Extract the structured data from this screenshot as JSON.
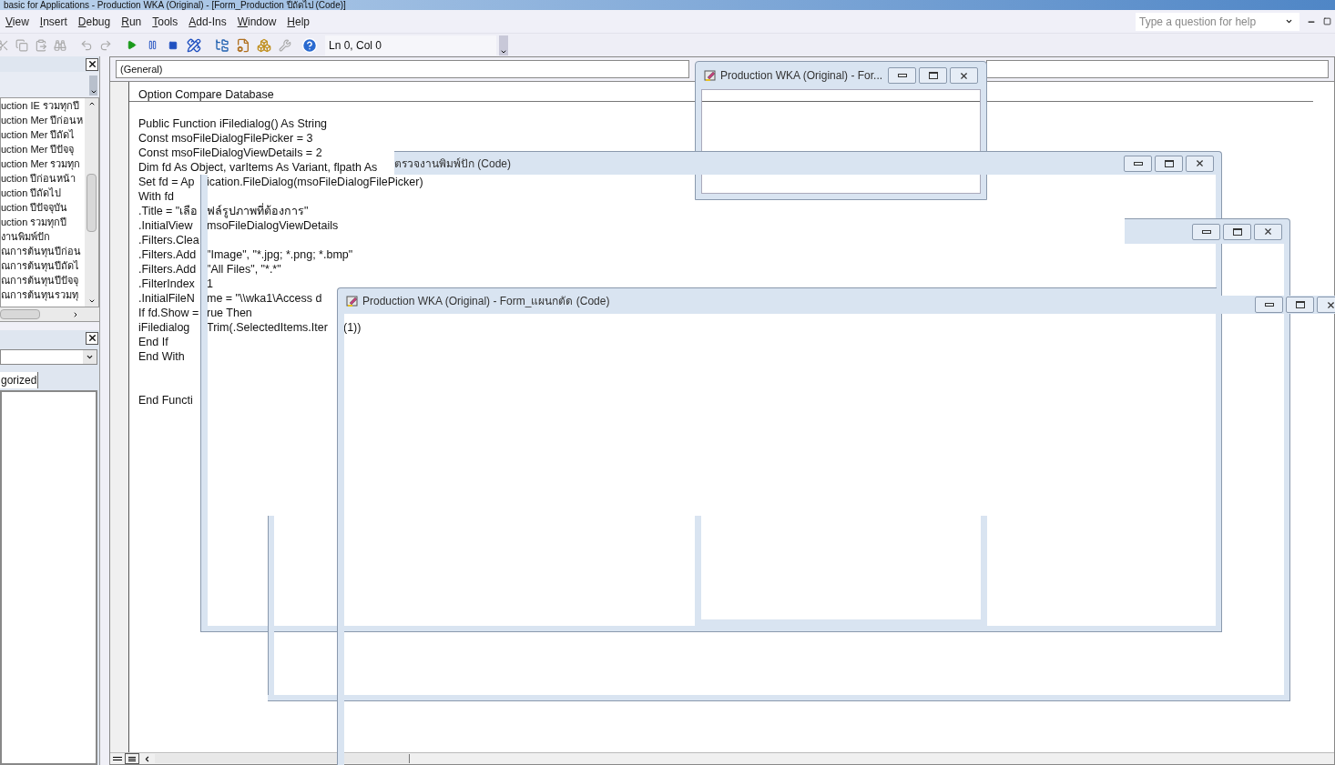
{
  "title_bar": {
    "title": "basic for Applications - Production WKA (Original) - [Form_Production ปีถัดไป (Code)]"
  },
  "menu": [
    "View",
    "Insert",
    "Debug",
    "Run",
    "Tools",
    "Add-Ins",
    "Window",
    "Help"
  ],
  "help_search": {
    "placeholder": "Type a question for help"
  },
  "toolbar": {
    "position": "Ln 0, Col 0"
  },
  "project_explorer": {
    "items": [
      "uction IE รวมทุกปี",
      "uction Mer ปีก่อนห",
      "uction Mer ปีถัดไ",
      "uction Mer ปีปัจจุ",
      "uction Mer รวมทุก",
      "uction ปีก่อนหน้า",
      "uction ปีถัดไป",
      "uction ปีปัจจุบัน",
      "uction รวมทุกปี",
      "งานพิมพ์ปัก",
      "ณการต้นทุนปีก่อน",
      "ณการต้นทุนปีถัดไ",
      "ณการต้นทุนปีปัจจุ",
      "ณการต้นทุนรวมทุ"
    ]
  },
  "properties": {
    "tab": "gorized"
  },
  "code_window": {
    "object_combo": "(General)",
    "lines": [
      {
        "kind": "code",
        "segments": [
          "Option Compare Database"
        ]
      },
      {
        "kind": "blank"
      },
      {
        "kind": "code",
        "segments": [
          "Public Function iFiledialog() As String"
        ]
      },
      {
        "kind": "code",
        "segments": [
          "Const msoFileDialogFilePicker = 3"
        ]
      },
      {
        "kind": "code",
        "segments": [
          "Const msoFileDialogViewDetails = 2"
        ]
      },
      {
        "kind": "code",
        "segments": [
          "Dim fd As Object, varItems As Variant, flpath As"
        ]
      },
      {
        "kind": "code",
        "segments": [
          "Set fd = Ap",
          "ication.FileDialog(msoFileDialogFilePicker)"
        ]
      },
      {
        "kind": "code",
        "segments": [
          "With fd"
        ]
      },
      {
        "kind": "code",
        "segments": [
          ".Title = \"เลือ",
          "ฟล์รูปภาพที่ต้องการ\""
        ]
      },
      {
        "kind": "code",
        "segments": [
          ".InitialView",
          "msoFileDialogViewDetails"
        ]
      },
      {
        "kind": "code",
        "segments": [
          ".Filters.Clea"
        ]
      },
      {
        "kind": "code",
        "segments": [
          ".Filters.Add",
          "\"Image\", \"*.jpg; *.png; *.bmp\""
        ]
      },
      {
        "kind": "code",
        "segments": [
          ".Filters.Add",
          "\"All Files\", \"*.*\""
        ]
      },
      {
        "kind": "code",
        "segments": [
          ".FilterIndex",
          "1"
        ]
      },
      {
        "kind": "code",
        "segments": [
          ".InitialFileN",
          "me = \"\\\\wka1\\Access d"
        ]
      },
      {
        "kind": "code",
        "segments": [
          "If fd.Show =",
          "rue Then"
        ]
      },
      {
        "kind": "code",
        "segments": [
          "iFiledialog",
          "Trim(.SelectedItems.Iter",
          "(1))"
        ]
      },
      {
        "kind": "code",
        "segments": [
          "End If"
        ]
      },
      {
        "kind": "code",
        "segments": [
          "End With"
        ]
      },
      {
        "kind": "blank"
      },
      {
        "kind": "blank"
      },
      {
        "kind": "code",
        "segments": [
          "End Functi"
        ]
      }
    ]
  },
  "windows": [
    {
      "title": "Production WKA (Original) - For..."
    },
    {
      "title": "ตรวจงานพิมพ์ปัก (Code)"
    },
    {
      "title": "Production WKA (Original) - Form_แผนกตัด (Code)"
    }
  ]
}
